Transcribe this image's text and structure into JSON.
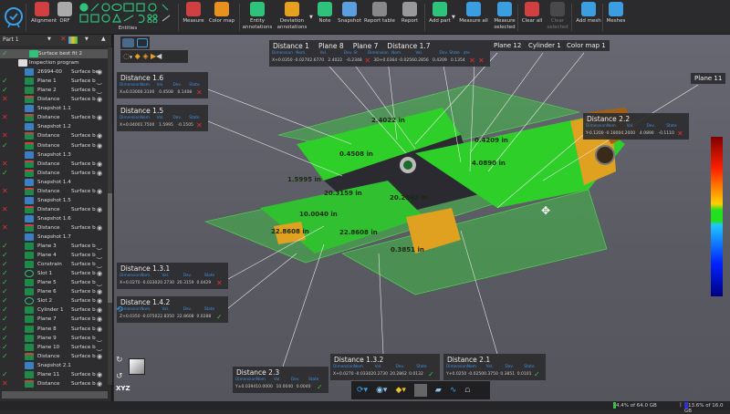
{
  "toolbar": {
    "items": [
      {
        "label": "Alignment",
        "icon": "alignment-icon"
      },
      {
        "label": "DRF",
        "icon": "drf-icon"
      },
      {
        "label": "Entities",
        "icon": "entities-icon"
      },
      {
        "label": "Measure",
        "icon": "measure-icon"
      },
      {
        "label": "Color map",
        "icon": "color-map-icon"
      },
      {
        "label": "Entity annotations",
        "icon": "entity-annotations-icon"
      },
      {
        "label": "Deviation annotations",
        "icon": "deviation-annotations-icon"
      },
      {
        "label": "Note",
        "icon": "note-icon"
      },
      {
        "label": "Snapshot",
        "icon": "snapshot-icon"
      },
      {
        "label": "Report table",
        "icon": "report-table-icon"
      },
      {
        "label": "Report",
        "icon": "report-icon"
      },
      {
        "label": "Add part",
        "icon": "add-part-icon"
      },
      {
        "label": "Measure all",
        "icon": "measure-all-icon"
      },
      {
        "label": "Measure selected",
        "icon": "measure-selected-icon"
      },
      {
        "label": "Clear all",
        "icon": "clear-all-icon"
      },
      {
        "label": "Clear selected",
        "icon": "clear-selected-icon",
        "disabled": true
      },
      {
        "label": "Add mesh",
        "icon": "add-mesh-icon"
      },
      {
        "label": "Meshes",
        "icon": "meshes-icon"
      }
    ]
  },
  "tree": {
    "part": "Part 1",
    "rows": [
      {
        "name": "Surface best fit 2",
        "icon": "fit",
        "state": "ok",
        "indent": 1,
        "selected": true
      },
      {
        "name": "Inspection program",
        "icon": "folder",
        "indent": 2
      },
      {
        "name": "26994-00",
        "surface": "Surface bes",
        "icon": "mesh",
        "eye": "open"
      },
      {
        "name": "Plane 1",
        "surface": "Surface b",
        "icon": "plane",
        "state": "ok",
        "eye": "closed"
      },
      {
        "name": "Plane 2",
        "surface": "Surface b",
        "icon": "plane",
        "state": "ok",
        "eye": "closed"
      },
      {
        "name": "Distance",
        "surface": "Surface b",
        "icon": "distance",
        "state": "fail",
        "eye": "open"
      },
      {
        "name": "Snapshot 1.1",
        "icon": "snapshot"
      },
      {
        "name": "Distance",
        "surface": "Surface b",
        "icon": "distance",
        "state": "fail",
        "eye": "open"
      },
      {
        "name": "Snapshot 1.2",
        "icon": "snapshot"
      },
      {
        "name": "Distance",
        "surface": "Surface b",
        "icon": "distance",
        "state": "fail",
        "eye": "open"
      },
      {
        "name": "Distance",
        "surface": "Surface b",
        "icon": "distance",
        "state": "ok",
        "eye": "open"
      },
      {
        "name": "Snapshot 1.3",
        "icon": "snapshot"
      },
      {
        "name": "Distance",
        "surface": "Surface b",
        "icon": "distance",
        "state": "fail",
        "eye": "open"
      },
      {
        "name": "Distance",
        "surface": "Surface b",
        "icon": "distance",
        "state": "ok",
        "eye": "open"
      },
      {
        "name": "Snapshot 1.4",
        "icon": "snapshot"
      },
      {
        "name": "Distance",
        "surface": "Surface b",
        "icon": "distance",
        "state": "fail",
        "eye": "open"
      },
      {
        "name": "Snapshot 1.5",
        "icon": "snapshot"
      },
      {
        "name": "Distance",
        "surface": "Surface b",
        "icon": "distance",
        "state": "fail",
        "eye": "open"
      },
      {
        "name": "Snapshot 1.6",
        "icon": "snapshot"
      },
      {
        "name": "Distance",
        "surface": "Surface b",
        "icon": "distance",
        "state": "fail",
        "eye": "open"
      },
      {
        "name": "Snapshot 1.7",
        "icon": "snapshot"
      },
      {
        "name": "Plane 3",
        "surface": "Surface b",
        "icon": "plane",
        "state": "ok",
        "eye": "closed"
      },
      {
        "name": "Plane 4",
        "surface": "Surface b",
        "icon": "plane",
        "state": "ok",
        "eye": "closed"
      },
      {
        "name": "Constrain",
        "surface": "Surface b",
        "icon": "plane",
        "state": "ok",
        "eye": "closed"
      },
      {
        "name": "Slot 1",
        "surface": "Surface b",
        "icon": "slot",
        "state": "ok",
        "eye": "open"
      },
      {
        "name": "Plane 5",
        "surface": "Surface b",
        "icon": "plane",
        "state": "ok",
        "eye": "closed"
      },
      {
        "name": "Plane 6",
        "surface": "Surface b",
        "icon": "plane",
        "state": "ok",
        "eye": "open"
      },
      {
        "name": "Slot 2",
        "surface": "Surface b",
        "icon": "slot",
        "state": "ok",
        "eye": "open"
      },
      {
        "name": "Cylinder 1",
        "surface": "Surface b",
        "icon": "plane",
        "state": "ok",
        "eye": "open"
      },
      {
        "name": "Plane 7",
        "surface": "Surface b",
        "icon": "plane",
        "state": "ok",
        "eye": "open"
      },
      {
        "name": "Plane 8",
        "surface": "Surface b",
        "icon": "plane",
        "state": "ok",
        "eye": "open"
      },
      {
        "name": "Plane 9",
        "surface": "Surface b",
        "icon": "plane",
        "state": "ok",
        "eye": "closed"
      },
      {
        "name": "Plane 10",
        "surface": "Surface b",
        "icon": "plane",
        "state": "ok",
        "eye": "closed"
      },
      {
        "name": "Distance",
        "surface": "Surface b",
        "icon": "distance",
        "state": "ok",
        "eye": "open"
      },
      {
        "name": "Snapshot 2.1",
        "icon": "snapshot"
      },
      {
        "name": "Plane 11",
        "surface": "Surface b",
        "icon": "plane",
        "state": "ok",
        "eye": "open"
      },
      {
        "name": "Distance",
        "surface": "Surface b",
        "icon": "distance",
        "state": "fail",
        "eye": "open"
      }
    ]
  },
  "table_headers": [
    "Dimension",
    "Nom.",
    "Val.",
    "Dev.",
    "State"
  ],
  "annotations": [
    {
      "id": "d16",
      "title": "Distance 1.6",
      "values": [
        "X±0.0300",
        "0.3100",
        "0.4508",
        "0.1408"
      ],
      "state": "fail"
    },
    {
      "id": "d15",
      "title": "Distance 1.5",
      "values": [
        "X+0.0400",
        "1.7500",
        "1.5995",
        "-0.1505"
      ],
      "state": "fail"
    },
    {
      "id": "d22",
      "title": "Distance 2.2",
      "values": [
        "Y-0.1200 -0.1800",
        "4.2000",
        "4.0890",
        "-0.1110"
      ],
      "state": "fail"
    },
    {
      "id": "d131",
      "title": "Distance 1.3.1",
      "values": [
        "X+0.0270 -0.0330",
        "20.2730",
        "20.3159",
        "0.0429"
      ],
      "state": "fail"
    },
    {
      "id": "d142",
      "title": "Distance 1.4.2",
      "values": [
        "Z+0.0350 -0.0750",
        "22.8350",
        "22.8608",
        "0.0288"
      ],
      "state": "ok"
    },
    {
      "id": "d23",
      "title": "Distance 2.3",
      "values": [
        "Y±0.0394",
        "10.0000",
        "10.0040",
        "0.0040"
      ],
      "state": "ok"
    },
    {
      "id": "d132",
      "title": "Distance 1.3.2",
      "values": [
        "X+0.0270 -0.0330",
        "20.2730",
        "20.2862",
        "0.0132"
      ],
      "state": "ok"
    },
    {
      "id": "d21",
      "title": "Distance 2.1",
      "values": [
        "Y+0.0250 -0.0250",
        "0.3750",
        "0.3851",
        "0.0101"
      ],
      "state": "ok"
    }
  ],
  "top_group": {
    "titles": [
      "Distance 1",
      "Plane 8",
      "Plane 7",
      "Distance 1.7"
    ],
    "headers": [
      "Dimension",
      "Nom.",
      "Val.",
      "Dev. St",
      "Dimension",
      "Nom.",
      "Val.",
      "Dev. State",
      "ate"
    ],
    "values": [
      "X+0.0350 -0.0270",
      "2.6770",
      "2.4022",
      "-0.2348",
      "3D+0.0364 -0.0256",
      "0.2856",
      "0.4209",
      "0.1354"
    ]
  },
  "tags": [
    "Plane 12",
    "Cylinder 1",
    "Color map 1",
    "Plane 11"
  ],
  "model_labels": [
    "2.4022 in",
    "0.4508 in",
    "0.4209 in",
    "4.0890 in",
    "1.5995 in",
    "20.3159 in",
    "20.2862 in",
    "10.0040 in",
    "22.8608 in",
    "22.8608 in",
    "0.3851 in"
  ],
  "view_axis_label": "XYZ",
  "status": {
    "memory": "4.4% of 64.0 GB",
    "memory_fraction": 0.044,
    "gpu": "13.6% of 16.0 GB",
    "gpu_fraction": 0.136,
    "separator": "|"
  },
  "colors": {
    "pass": "#3ac04a",
    "fail": "#e03030",
    "header": "#3b8fe0",
    "part_green": "#2fcf2a",
    "part_orange": "#e0a020"
  }
}
